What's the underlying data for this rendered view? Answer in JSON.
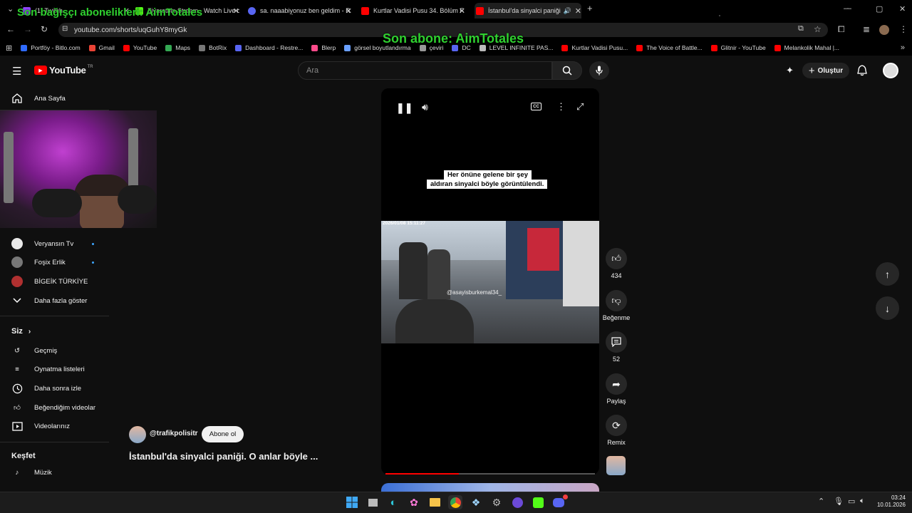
{
  "browser": {
    "tabs": [
      {
        "title": "(1) Twitch",
        "color": "#9146ff"
      },
      {
        "title": "Ziyaretbin Stream - Watch Live o",
        "color": "#53fc18"
      },
      {
        "title": "sa. naaabiyonuz ben geldim - R",
        "color": "#5865f2"
      },
      {
        "title": "Kurtlar Vadisi Pusu 34. Bölüm F",
        "color": "#ff0000"
      },
      {
        "title": "İstanbul'da sinyalci paniği",
        "color": "#ff0000"
      }
    ],
    "url": "youtube.com/shorts/uqGuhY8myGk",
    "bookmarks": [
      {
        "label": "Portföy - Bitlo.com",
        "color": "#2f6bff"
      },
      {
        "label": "Gmail",
        "color": "#ea4335"
      },
      {
        "label": "YouTube",
        "color": "#ff0000"
      },
      {
        "label": "Maps",
        "color": "#34a853"
      },
      {
        "label": "BotRix",
        "color": "#777777"
      },
      {
        "label": "Dashboard - Restre...",
        "color": "#5865f2"
      },
      {
        "label": "Blerp",
        "color": "#ff4b8b"
      },
      {
        "label": "görsel boyutlandırma",
        "color": "#6aa0ff"
      },
      {
        "label": "çeviri",
        "color": "#999999"
      },
      {
        "label": "DC",
        "color": "#5865f2"
      },
      {
        "label": "LEVEL INFINITE PAS...",
        "color": "#bbbbbb"
      },
      {
        "label": "Kurtlar Vadisi Pusu...",
        "color": "#ff0000"
      },
      {
        "label": "The Voice of Battle...",
        "color": "#ff0000"
      },
      {
        "label": "Glitnir - YouTube",
        "color": "#ff0000"
      },
      {
        "label": "Melankolik Mahal |...",
        "color": "#ff0000"
      }
    ]
  },
  "overlays": {
    "donor": "Son bağışçı abonelikleri: AimTotales",
    "subscriber": "Son abone: AimTotales"
  },
  "yt": {
    "logo": "YouTube",
    "region": "TR",
    "search_placeholder": "Ara",
    "create_label": "Oluştur"
  },
  "sidebar": {
    "home": "Ana Sayfa",
    "subs": [
      {
        "label": "Veryansın Tv",
        "color": "#e9e9e9"
      },
      {
        "label": "Foşix Erlik",
        "color": "#777777"
      },
      {
        "label": "BİGEİK TÜRKİYE",
        "color": "#b03030"
      }
    ],
    "show_more": "Daha fazla göster",
    "you_title": "Siz",
    "you_items": [
      "Geçmiş",
      "Oynatma listeleri",
      "Daha sonra izle",
      "Beğendiğim videolar",
      "Videolarınız"
    ],
    "explore_title": "Keşfet",
    "explore_items": [
      "Müzik"
    ]
  },
  "video": {
    "caption_line1": "Her önüne gelene bir şey",
    "caption_line2": "aldıran sinyalci böyle görüntülendi.",
    "timestamp": "2026/01/08 15:11:27",
    "watermark": "@asayisburkemal34_",
    "progress": 0.35
  },
  "channel": {
    "handle": "@trafikpolisitr",
    "subscribe": "Abone ol",
    "title": "İstanbul'da sinyalci paniği. O anlar böyle ..."
  },
  "actions": {
    "likes": "434",
    "dislike": "Beğenme",
    "comments": "52",
    "share": "Paylaş",
    "remix": "Remix"
  },
  "clock": {
    "time": "03:24",
    "date": "10.01.2026"
  }
}
